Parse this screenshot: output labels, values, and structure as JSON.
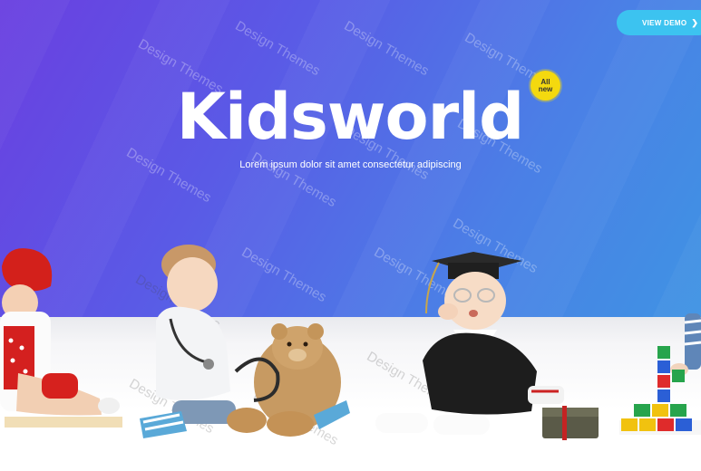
{
  "header": {
    "view_demo_label": "VIEW DEMO",
    "view_demo_icon": "chevron-right-icon"
  },
  "hero": {
    "title": "Kidsworld",
    "badge_line1": "All",
    "badge_line2": "new",
    "tagline": "Lorem ipsum dolor sit amet consectetur adipiscing"
  },
  "watermark": {
    "text": "Design Themes"
  },
  "colors": {
    "hero_start": "#6a3fe0",
    "hero_end": "#3f93e3",
    "button": "#3cc3f0",
    "badge": "#f4d90f"
  },
  "illustrations": [
    "girl-red-hat-image",
    "boy-doctor-with-teddy-image",
    "baby-graduate-image",
    "boy-with-blocks-image"
  ]
}
